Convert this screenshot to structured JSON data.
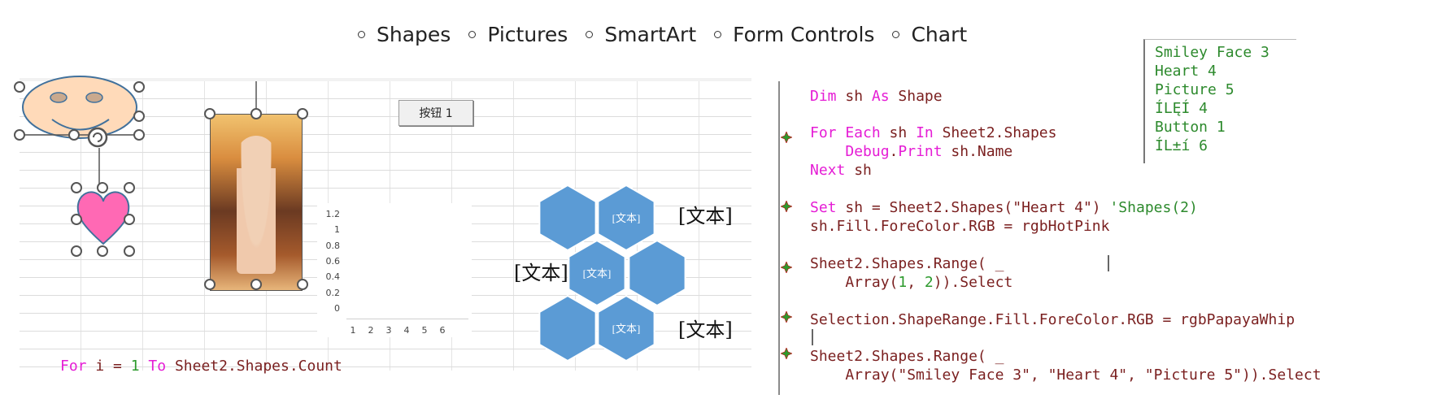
{
  "top_options": [
    {
      "label": "Shapes"
    },
    {
      "label": "Pictures"
    },
    {
      "label": "SmartArt"
    },
    {
      "label": "Form Controls"
    },
    {
      "label": "Chart"
    }
  ],
  "sheet": {
    "button_label": "按钮 1",
    "chart_data": {
      "type": "bar",
      "categories": [
        "1",
        "2",
        "3",
        "4",
        "5",
        "6"
      ],
      "values": [],
      "title": "",
      "y_ticks": [
        "1.2",
        "1",
        "0.8",
        "0.6",
        "0.4",
        "0.2",
        "0"
      ],
      "ylim": [
        0,
        1.2
      ],
      "grid": false
    },
    "smartart": {
      "hex_texts": [
        "[文本]",
        "[文本]",
        "[文本]"
      ],
      "callouts": [
        "[文本]",
        "[文本]",
        "[文本]"
      ],
      "fill_color": "#5b9bd5"
    },
    "code_bottom": {
      "kw1": "For",
      "var": "i",
      "eq": "=",
      "num": "1",
      "kw2": "To",
      "rest": "Sheet2.Shapes.Count"
    }
  },
  "editor": {
    "lines": [
      {
        "parts": [
          {
            "t": "Dim",
            "c": "kw"
          },
          {
            "t": " sh ",
            "c": "plain"
          },
          {
            "t": "As",
            "c": "kw"
          },
          {
            "t": " Shape",
            "c": "plain"
          }
        ]
      },
      {
        "parts": [
          {
            "t": "For Each",
            "c": "kw"
          },
          {
            "t": " sh ",
            "c": "plain"
          },
          {
            "t": "In",
            "c": "kw"
          },
          {
            "t": " Sheet2.Shapes",
            "c": "plain"
          }
        ]
      },
      {
        "parts": [
          {
            "t": "    ",
            "c": "plain"
          },
          {
            "t": "Debug",
            "c": "kw"
          },
          {
            "t": ".",
            "c": "plain"
          },
          {
            "t": "Print",
            "c": "kw"
          },
          {
            "t": " sh.Name",
            "c": "plain"
          }
        ]
      },
      {
        "parts": [
          {
            "t": "Next",
            "c": "kw"
          },
          {
            "t": " sh",
            "c": "plain"
          }
        ]
      },
      {
        "parts": [
          {
            "t": "Set",
            "c": "kw"
          },
          {
            "t": " sh = Sheet2.Shapes(\"Heart 4\") ",
            "c": "plain"
          },
          {
            "t": "'Shapes(2)",
            "c": "com"
          }
        ]
      },
      {
        "parts": [
          {
            "t": "sh.Fill.ForeColor.RGB = rgbHotPink",
            "c": "plain"
          }
        ]
      },
      {
        "parts": [
          {
            "t": "Sheet2.Shapes.Range( _",
            "c": "plain"
          }
        ]
      },
      {
        "parts": [
          {
            "t": "    Array(",
            "c": "plain"
          },
          {
            "t": "1",
            "c": "num"
          },
          {
            "t": ", ",
            "c": "plain"
          },
          {
            "t": "2",
            "c": "num"
          },
          {
            "t": ")).Select",
            "c": "plain"
          }
        ]
      },
      {
        "parts": [
          {
            "t": "Selection.ShapeRange.Fill.ForeColor.RGB = rgbPapayaWhip",
            "c": "plain"
          }
        ]
      },
      {
        "parts": [
          {
            "t": "Sheet2.Shapes.Range( _",
            "c": "plain"
          }
        ]
      },
      {
        "parts": [
          {
            "t": "    Array(\"Smiley Face 3\", \"Heart 4\", \"Picture 5\")).Select",
            "c": "plain"
          }
        ]
      }
    ]
  },
  "immediate": {
    "lines": [
      "Smiley Face 3",
      "Heart 4",
      "Picture 5",
      "ÍLĘÍ 4",
      "Button 1",
      "ÍL±í 6"
    ]
  },
  "colors": {
    "keyword": "#e51cd5",
    "number": "#2d9a2d",
    "text": "#7a1f1f",
    "immediate_text": "#2d8a2d",
    "heart": "#ff69b4",
    "smiley": "#ffdab9",
    "smartart": "#5b9bd5"
  }
}
